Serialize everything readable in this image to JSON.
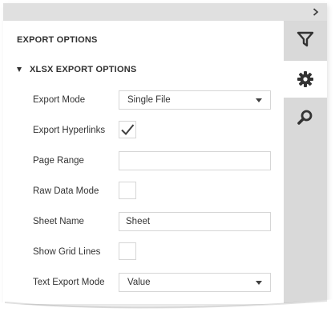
{
  "panel": {
    "section_title": "EXPORT OPTIONS",
    "group_title": "XLSX EXPORT OPTIONS"
  },
  "rail": {
    "tabs": [
      {
        "icon": "filter-icon",
        "active": false
      },
      {
        "icon": "gear-icon",
        "active": true
      },
      {
        "icon": "search-icon",
        "active": false
      }
    ]
  },
  "fields": {
    "export_mode": {
      "label": "Export Mode",
      "value": "Single File"
    },
    "export_hyperlinks": {
      "label": "Export Hyperlinks",
      "checked": true
    },
    "page_range": {
      "label": "Page Range",
      "value": ""
    },
    "raw_data_mode": {
      "label": "Raw Data Mode",
      "checked": false
    },
    "sheet_name": {
      "label": "Sheet Name",
      "value": "Sheet"
    },
    "show_grid_lines": {
      "label": "Show Grid Lines",
      "checked": false
    },
    "text_export_mode": {
      "label": "Text Export Mode",
      "value": "Value"
    }
  },
  "colors": {
    "rail_bg": "#d9d9d9",
    "topbar_bg": "#e0e0e0",
    "icon": "#333333",
    "border": "#d6d6d6"
  }
}
